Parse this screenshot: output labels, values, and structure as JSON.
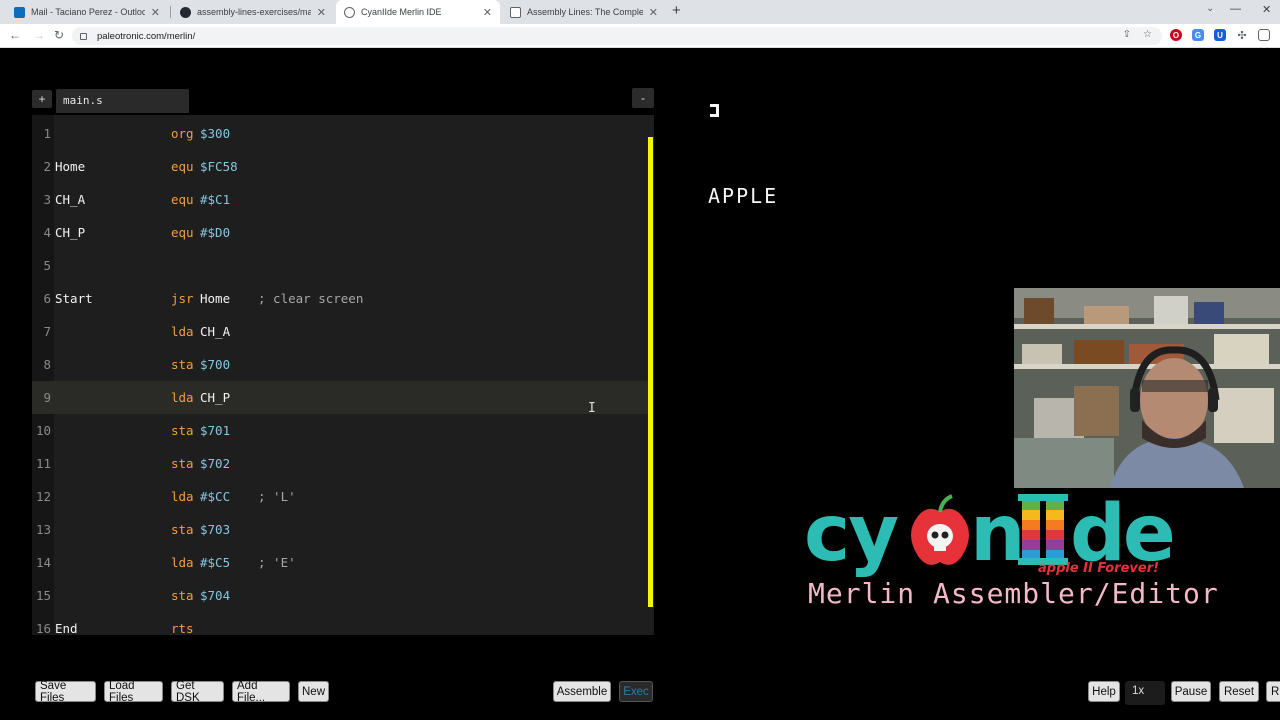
{
  "browser": {
    "tabs": [
      {
        "title": "Mail - Taciano Perez - Outlook",
        "icon": "outlook-icon"
      },
      {
        "title": "assembly-lines-exercises/main.s",
        "icon": "github-icon"
      },
      {
        "title": "CyanIIde Merlin IDE",
        "icon": "globe-icon"
      },
      {
        "title": "Assembly Lines: The Complete Bo",
        "icon": "document-icon"
      }
    ],
    "new_tab": "+",
    "url": "paleotronic.com/merlin/"
  },
  "ide": {
    "add_file_symbol": "+",
    "file_tab": "main.s",
    "minimize_symbol": "-",
    "lines": [
      {
        "n": "1",
        "label": "",
        "op": "org",
        "operand": "$300",
        "comment": ""
      },
      {
        "n": "2",
        "label": "Home",
        "op": "equ",
        "operand": "$FC58",
        "comment": ""
      },
      {
        "n": "3",
        "label": "CH_A",
        "op": "equ",
        "operand": "#$C1",
        "comment": ""
      },
      {
        "n": "4",
        "label": "CH_P",
        "op": "equ",
        "operand": "#$D0",
        "comment": ""
      },
      {
        "n": "5",
        "label": "",
        "op": "",
        "operand": "",
        "comment": ""
      },
      {
        "n": "6",
        "label": "Start",
        "op": "jsr",
        "operand": "Home",
        "comment": "; clear screen"
      },
      {
        "n": "7",
        "label": "",
        "op": "lda",
        "operand": "CH_A",
        "comment": ""
      },
      {
        "n": "8",
        "label": "",
        "op": "sta",
        "operand": "$700",
        "comment": ""
      },
      {
        "n": "9",
        "label": "",
        "op": "lda",
        "operand": "CH_P",
        "comment": ""
      },
      {
        "n": "10",
        "label": "",
        "op": "sta",
        "operand": "$701",
        "comment": ""
      },
      {
        "n": "11",
        "label": "",
        "op": "sta",
        "operand": "$702",
        "comment": ""
      },
      {
        "n": "12",
        "label": "",
        "op": "lda",
        "operand": "#$CC",
        "comment": "; 'L'"
      },
      {
        "n": "13",
        "label": "",
        "op": "sta",
        "operand": "$703",
        "comment": ""
      },
      {
        "n": "14",
        "label": "",
        "op": "lda",
        "operand": "#$C5",
        "comment": "; 'E'"
      },
      {
        "n": "15",
        "label": "",
        "op": "sta",
        "operand": "$704",
        "comment": ""
      },
      {
        "n": "16",
        "label": "End",
        "op": "rts",
        "operand": "",
        "comment": ""
      }
    ],
    "current_line": "9",
    "buttons": {
      "save": "Save Files",
      "load": "Load Files",
      "get_dsk": "Get DSK",
      "add_file": "Add File...",
      "new": "New",
      "assemble": "Assemble",
      "exec": "Exec"
    }
  },
  "emulator": {
    "screen_text": "APPLE",
    "controls": {
      "help": "Help",
      "speed": "1x",
      "pause": "Pause",
      "reset": "Reset",
      "cut_off": "R"
    }
  },
  "logo": {
    "wordmark": "cyanIIde",
    "tagline": "apple II Forever!",
    "subtitle": "Merlin Assembler/Editor"
  },
  "colors": {
    "scrollbar": "#f5f500",
    "opcode": "#f0a040",
    "number": "#86c7e0",
    "logo_teal": "#2cbcb4",
    "logo_pink": "#f4b8c8",
    "logo_red": "#e8323a"
  }
}
